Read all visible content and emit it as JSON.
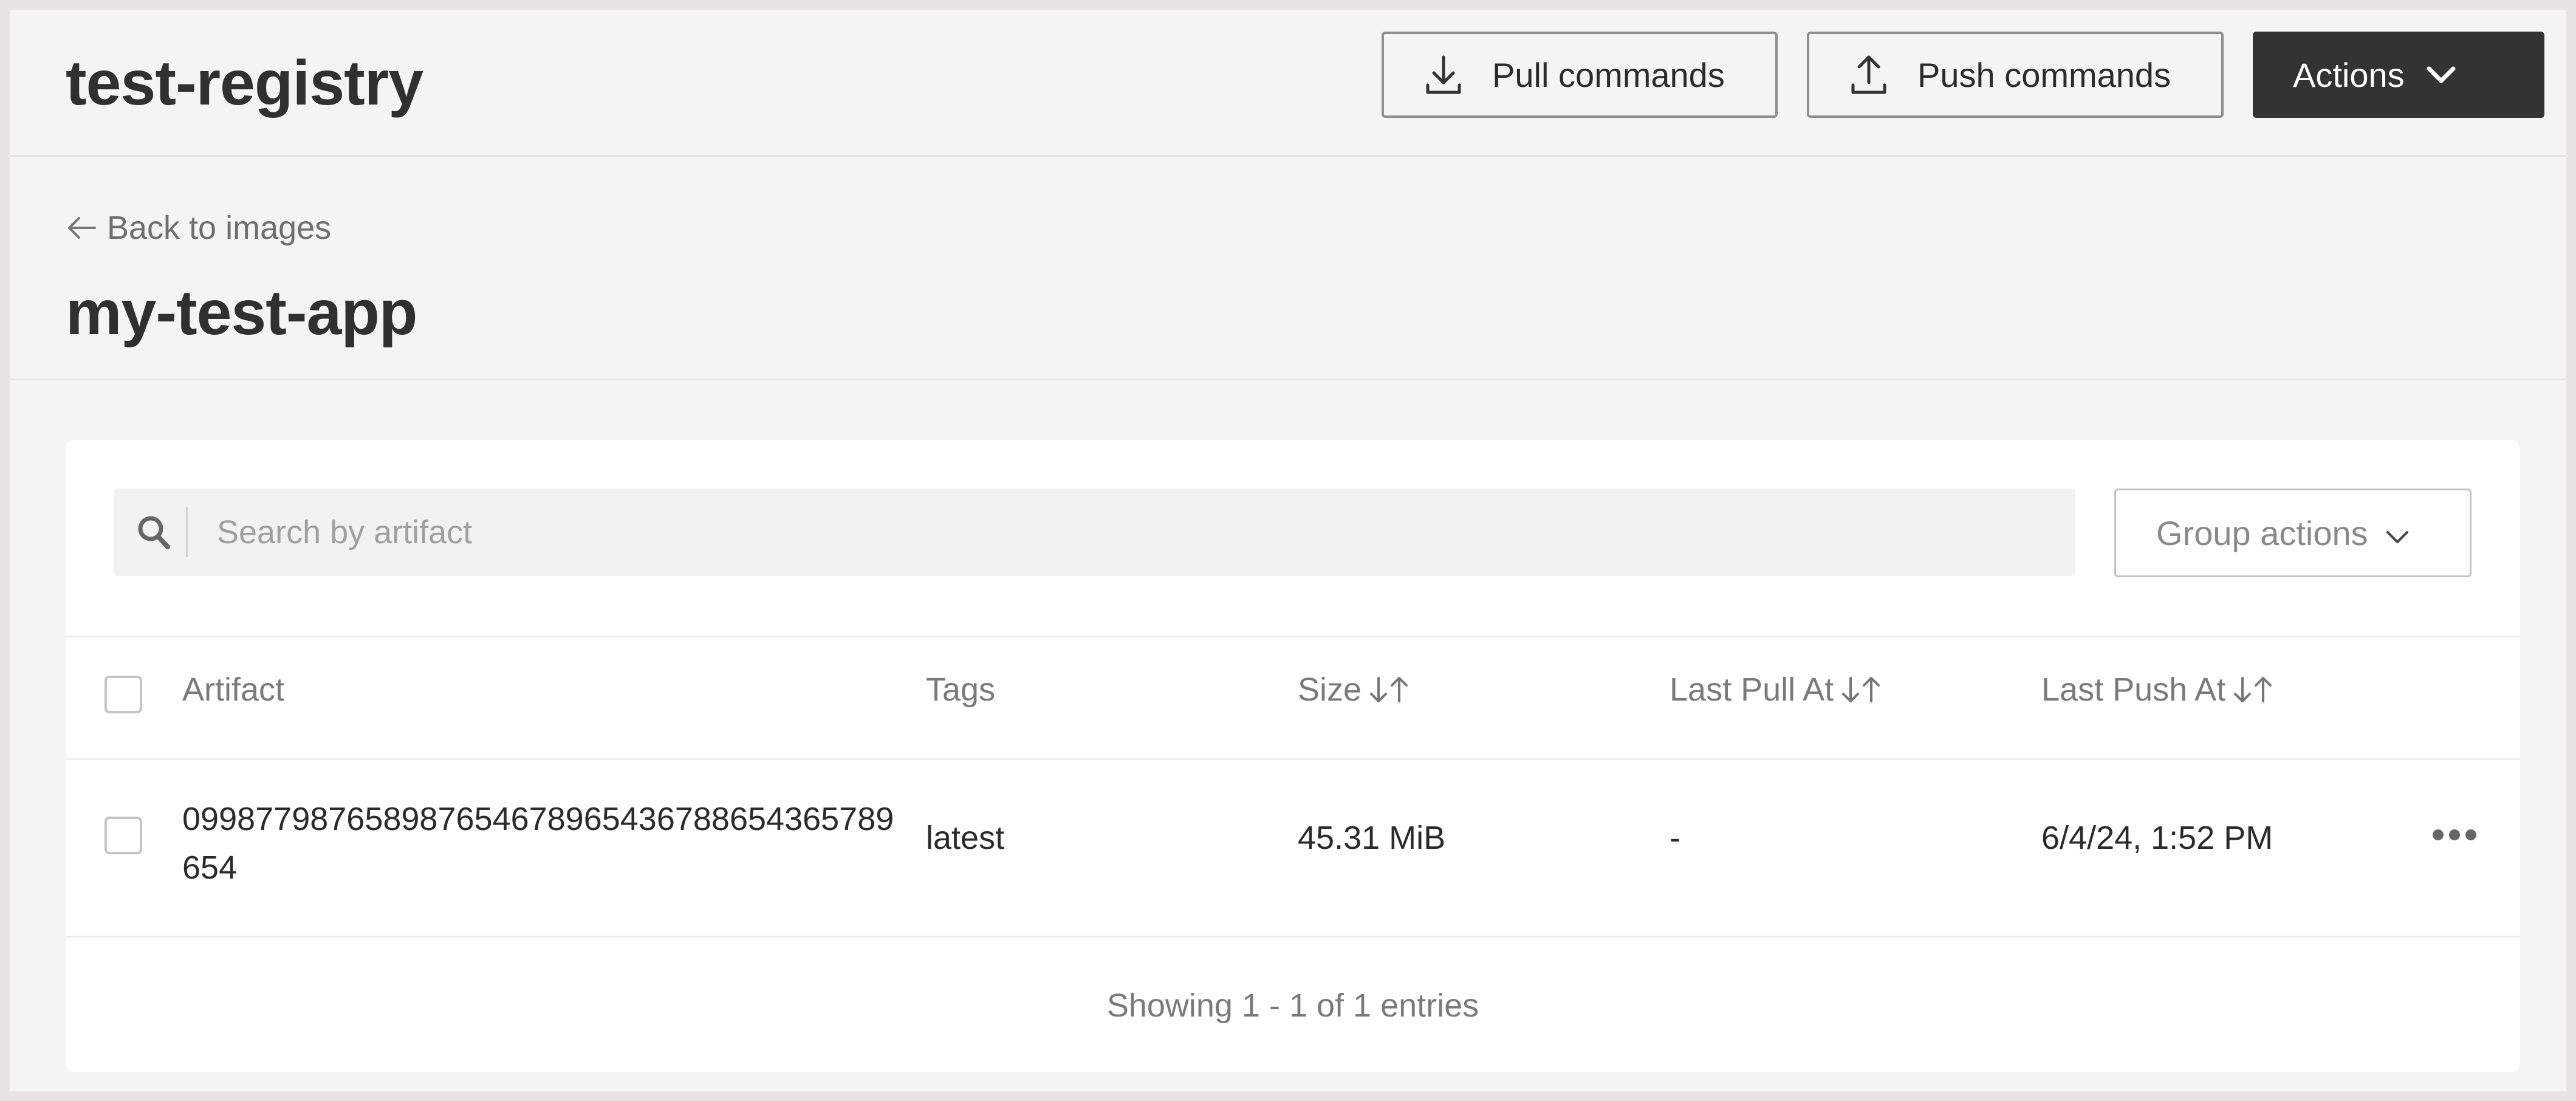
{
  "header": {
    "registry_name": "test-registry",
    "pull_label": "Pull commands",
    "push_label": "Push commands",
    "actions_label": "Actions"
  },
  "subheader": {
    "back_label": "Back to images",
    "image_name": "my-test-app"
  },
  "search": {
    "placeholder": "Search by artifact",
    "value": ""
  },
  "group_actions_label": "Group actions",
  "table": {
    "columns": {
      "artifact": "Artifact",
      "tags": "Tags",
      "size": "Size",
      "last_pull": "Last Pull At",
      "last_push": "Last Push At"
    },
    "rows": [
      {
        "artifact": "099877987658987654678965436788654365789654",
        "tags": "latest",
        "size": "45.31 MiB",
        "last_pull": "-",
        "last_push": "6/4/24, 1:52 PM"
      }
    ]
  },
  "footer": {
    "entries_text": "Showing 1 - 1 of 1 entries"
  },
  "icons": {
    "pull": "download-icon",
    "push": "upload-icon",
    "actions": "chevron-down-icon",
    "back": "arrow-left-icon",
    "search": "search-icon",
    "sort": "sort-icon",
    "row_menu": "more-horizontal-icon"
  },
  "colors": {
    "page_bg": "#f4f4f4",
    "primary_button": "#333333",
    "card_bg": "#ffffff"
  }
}
